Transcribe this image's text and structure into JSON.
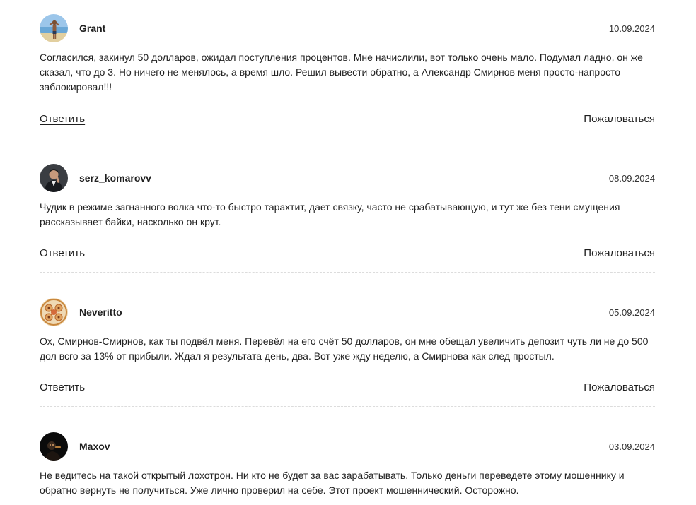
{
  "comments": [
    {
      "username": "Grant",
      "date": "10.09.2024",
      "text": "Согласился, закинул 50 долларов, ожидал поступления процентов. Мне начислили, вот только очень мало. Подумал ладно, он же сказал, что до 3. Но ничего не менялось, а время шло. Решил вывести обратно, а Александр Смирнов меня просто-напросто заблокировал!!!",
      "reply_label": "Ответить",
      "report_label": "Пожаловаться"
    },
    {
      "username": "serz_komarovv",
      "date": "08.09.2024",
      "text": "Чудик в режиме загнанного волка что-то быстро тарахтит, дает связку, часто не срабатывающую, и тут же без тени смущения рассказывает байки, насколько он крут.",
      "reply_label": "Ответить",
      "report_label": "Пожаловаться"
    },
    {
      "username": "Neveritto",
      "date": "05.09.2024",
      "text": "Ох, Смирнов-Смирнов, как ты подвёл меня. Перевёл на его счёт 50 долларов, он мне обещал увеличить депозит чуть ли не до 500 дол всго за 13% от прибыли. Ждал я результата день, два. Вот уже жду неделю, а Смирнова как след простыл.",
      "reply_label": "Ответить",
      "report_label": "Пожаловаться"
    },
    {
      "username": "Maxov",
      "date": "03.09.2024",
      "text": "Не ведитесь на такой открытый лохотрон. Ни кто не будет за вас зарабатывать. Только деньги переведете этому мошеннику и обратно вернуть не получиться. Уже лично проверил на себе. Этот проект мошеннический. Осторожно."
    }
  ]
}
